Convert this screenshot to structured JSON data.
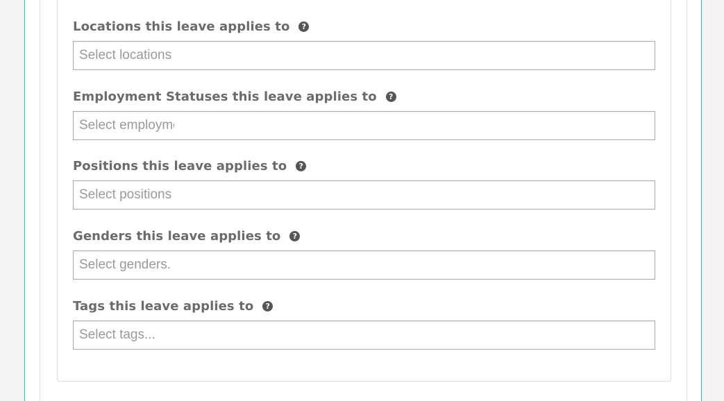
{
  "fields": [
    {
      "label": "Locations this leave applies to",
      "placeholder": "Select locations"
    },
    {
      "label": "Employment Statuses this leave applies to",
      "placeholder": "Select employment statuses..."
    },
    {
      "label": "Positions this leave applies to",
      "placeholder": "Select positions"
    },
    {
      "label": "Genders this leave applies to",
      "placeholder": "Select genders."
    },
    {
      "label": "Tags this leave applies to",
      "placeholder": "Select tags..."
    }
  ],
  "help_icon_glyph": "?",
  "icon": "question-circle-icon",
  "colors": {
    "accent_border": "#3bb9c1",
    "label_text": "#6b6b6b",
    "placeholder_text": "#9a9a9a",
    "help_icon_bg": "#555555"
  }
}
